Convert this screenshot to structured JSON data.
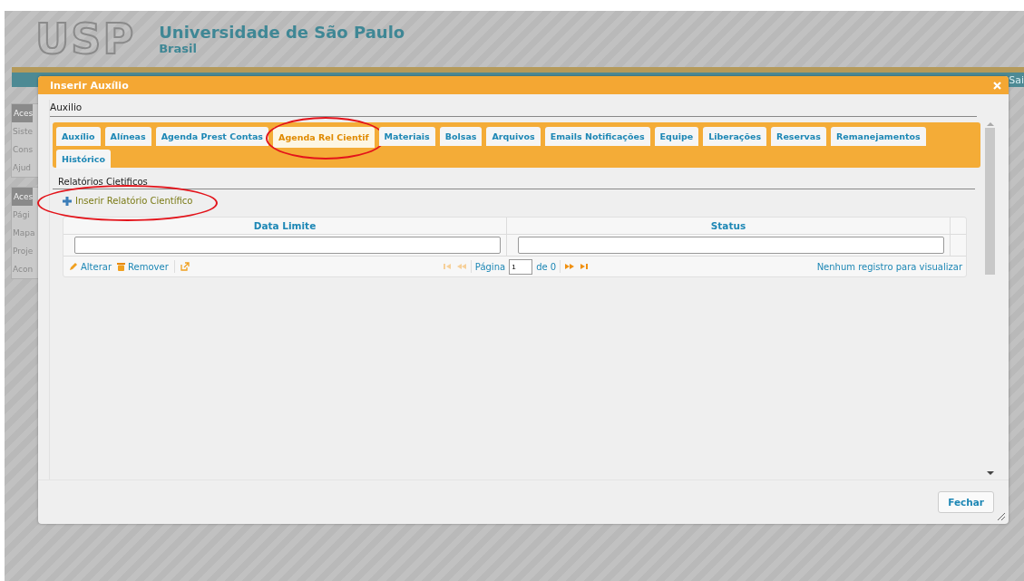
{
  "page": {
    "logo": "USP",
    "university": "Universidade de São Paulo",
    "country": "Brasil",
    "top_right": "Sai",
    "sidebar": [
      {
        "header": "Aces",
        "items": [
          "Siste",
          "Cons",
          "Ajud"
        ]
      },
      {
        "header": "Aces",
        "items": [
          "Pági",
          "Mapa",
          "Proje",
          "Acon"
        ]
      }
    ]
  },
  "dialog": {
    "title": "Inserir Auxílio",
    "section": "Auxilio",
    "tabs": [
      {
        "label": "Auxílio",
        "selected": false,
        "circled": false
      },
      {
        "label": "Alíneas",
        "selected": false,
        "circled": false
      },
      {
        "label": "Agenda Prest Contas",
        "selected": false,
        "circled": false
      },
      {
        "label": "Agenda Rel Cientif",
        "selected": true,
        "circled": true
      },
      {
        "label": "Materiais",
        "selected": false,
        "circled": false
      },
      {
        "label": "Bolsas",
        "selected": false,
        "circled": false
      },
      {
        "label": "Arquivos",
        "selected": false,
        "circled": false
      },
      {
        "label": "Emails Notificações",
        "selected": false,
        "circled": false
      },
      {
        "label": "Equipe",
        "selected": false,
        "circled": false
      },
      {
        "label": "Liberações",
        "selected": false,
        "circled": false
      },
      {
        "label": "Reservas",
        "selected": false,
        "circled": false
      },
      {
        "label": "Remanejamentos",
        "selected": false,
        "circled": false
      },
      {
        "label": "Histórico",
        "selected": false,
        "circled": false
      }
    ],
    "subsection": "Relatórios Cietificos",
    "insert_link": {
      "label": "Inserir Relatório Científico",
      "circled": true
    },
    "grid": {
      "columns": [
        "Data Limite",
        "Status"
      ],
      "actions": [
        {
          "kind": "edit",
          "label": "Alterar"
        },
        {
          "kind": "remove",
          "label": "Remover"
        },
        {
          "kind": "export"
        }
      ],
      "pager": {
        "page_label": "Página",
        "page": "1",
        "of": "de 0"
      },
      "empty_message": "Nenhum registro para visualizar"
    },
    "buttons": [
      "Fechar"
    ]
  }
}
